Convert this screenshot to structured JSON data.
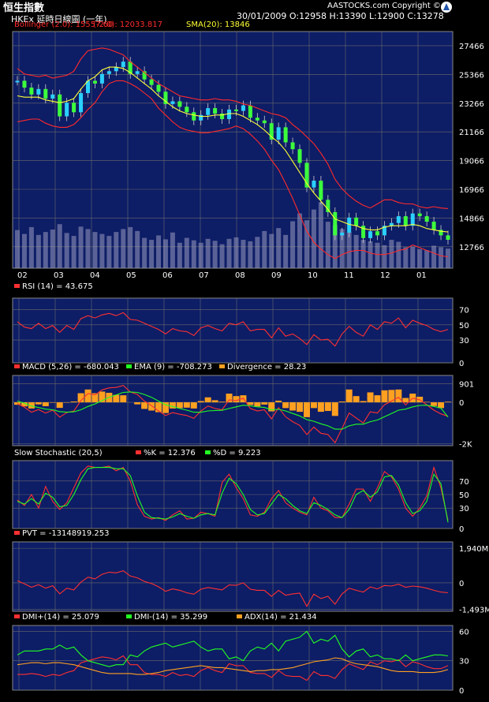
{
  "header": {
    "title": "恒生指數",
    "subtitle": "HKEx 延時日線圖 (一年)",
    "ohlc": "30/01/2009  O:12958  H:13390  L:12900  C:13278",
    "brand": "AASTOCKS.com Copyright ©"
  },
  "colors": {
    "panel_bg": "#0d1d66",
    "grid": "#6b6b6b",
    "price_up": "#2ad0ff",
    "price_down": "#3cff3c",
    "bollinger": "#ff2a2a",
    "sma": "#ffff33",
    "volume": "#9b9bc0",
    "rsi": "#ff3030",
    "macd": "#ff3030",
    "ema": "#22ff22",
    "divergence": "#ffa020",
    "k": "#ff3030",
    "d": "#22ff22",
    "pvt": "#ff3030",
    "dmi_plus": "#ff3030",
    "dmi_minus": "#22ff22",
    "adx": "#ffa020"
  },
  "chart_data": [
    {
      "type": "line",
      "panel": "price",
      "legend": [
        "Bollinger (2.0): 15557.60",
        "(-2.0): 12033.817",
        "SMA(20): 13846"
      ],
      "x_ticks": [
        "02",
        "03",
        "04",
        "05",
        "06",
        "07",
        "08",
        "09",
        "10",
        "11",
        "12",
        "01"
      ],
      "y_ticks": [
        27466,
        25366,
        23266,
        21166,
        19066,
        16966,
        14866,
        12766
      ],
      "ylim": [
        11200,
        28500
      ],
      "series": [
        {
          "name": "Close",
          "values": [
            24900,
            24400,
            23900,
            24300,
            23600,
            23900,
            22300,
            23300,
            22600,
            24000,
            24900,
            24700,
            25400,
            25600,
            25900,
            26300,
            25400,
            25600,
            25000,
            24600,
            24100,
            23200,
            23400,
            23000,
            22600,
            22000,
            22400,
            22900,
            22500,
            22100,
            22800,
            22700,
            23100,
            22200,
            22000,
            21800,
            20600,
            21500,
            20400,
            19900,
            18900,
            17100,
            17600,
            16200,
            15300,
            13600,
            13800,
            14900,
            14300,
            13400,
            13900,
            13600,
            14300,
            14500,
            15000,
            14300,
            15200,
            15000,
            14600,
            14000,
            13600,
            13278
          ]
        },
        {
          "name": "Bollinger Upper",
          "values": [
            25800,
            25400,
            25300,
            25200,
            25300,
            25100,
            25200,
            25300,
            25600,
            26500,
            27100,
            27200,
            27300,
            27200,
            27000,
            26800,
            26300,
            25900,
            25500,
            25100,
            24700,
            24400,
            24100,
            23800,
            23700,
            23600,
            23500,
            23500,
            23600,
            23500,
            23500,
            23400,
            23200,
            23100,
            22900,
            22700,
            22500,
            22400,
            22200,
            21700,
            21300,
            20800,
            20300,
            19600,
            18800,
            17700,
            17000,
            16500,
            16100,
            15800,
            15600,
            15900,
            16200,
            16200,
            16000,
            15900,
            15900,
            15700,
            15600,
            15700,
            15600,
            15558
          ]
        },
        {
          "name": "Bollinger Lower",
          "values": [
            21900,
            22000,
            22100,
            22100,
            21800,
            21600,
            21500,
            21500,
            21700,
            22200,
            22800,
            23300,
            24100,
            24700,
            24900,
            24900,
            24700,
            24400,
            24000,
            23600,
            22900,
            22400,
            21900,
            21500,
            21300,
            21200,
            21100,
            21100,
            21200,
            21300,
            21400,
            21600,
            21400,
            21000,
            20500,
            19900,
            19100,
            18400,
            17400,
            16300,
            15100,
            13900,
            13100,
            12600,
            12200,
            11900,
            12200,
            12400,
            12500,
            12500,
            12300,
            12200,
            12200,
            12300,
            12500,
            12600,
            12900,
            12700,
            12500,
            12300,
            12100,
            12034
          ]
        },
        {
          "name": "SMA",
          "values": [
            23800,
            23700,
            23700,
            23700,
            23500,
            23400,
            23300,
            23400,
            23600,
            24300,
            24900,
            25200,
            25700,
            25900,
            25900,
            25800,
            25500,
            25100,
            24700,
            24300,
            23800,
            23400,
            23000,
            22700,
            22500,
            22400,
            22300,
            22300,
            22400,
            22400,
            22500,
            22500,
            22300,
            22000,
            21700,
            21300,
            20800,
            20400,
            19800,
            19000,
            18200,
            17400,
            16700,
            16100,
            15500,
            14800,
            14600,
            14400,
            14300,
            14100,
            14000,
            14000,
            14200,
            14300,
            14300,
            14300,
            14400,
            14300,
            14100,
            14000,
            13900,
            13846
          ]
        }
      ],
      "volume": [
        78,
        70,
        84,
        68,
        74,
        79,
        90,
        72,
        66,
        85,
        80,
        74,
        70,
        66,
        74,
        80,
        84,
        76,
        62,
        58,
        67,
        59,
        73,
        52,
        62,
        57,
        52,
        60,
        56,
        49,
        60,
        63,
        58,
        55,
        64,
        76,
        70,
        82,
        68,
        96,
        112,
        98,
        120,
        135,
        95,
        88,
        80,
        74,
        68,
        58,
        55,
        52,
        47,
        58,
        54,
        43,
        44,
        39,
        37,
        46,
        43,
        40
      ]
    },
    {
      "type": "line",
      "panel": "rsi",
      "legend": [
        "RSI (14) = 43.675"
      ],
      "y_ticks": [
        70,
        50,
        30,
        0
      ],
      "ylim": [
        0,
        85
      ],
      "series": [
        {
          "name": "RSI (14)",
          "values": [
            54,
            47,
            45,
            52,
            45,
            49,
            40,
            49,
            44,
            58,
            62,
            59,
            63,
            65,
            62,
            66,
            57,
            56,
            52,
            48,
            44,
            38,
            45,
            42,
            41,
            36,
            46,
            49,
            45,
            42,
            52,
            50,
            54,
            42,
            44,
            44,
            33,
            46,
            35,
            38,
            32,
            24,
            37,
            30,
            31,
            22,
            38,
            48,
            40,
            35,
            50,
            44,
            54,
            52,
            59,
            46,
            56,
            52,
            49,
            44,
            41,
            44
          ]
        }
      ]
    },
    {
      "type": "line",
      "panel": "macd",
      "legend": [
        "MACD (5,26) = -680.043",
        "EMA (9) = -708.273",
        "Divergence = 28.23"
      ],
      "y_ticks": [
        901,
        0,
        -2000
      ],
      "y_tick_labels": [
        "901",
        "0",
        "-2K"
      ],
      "ylim": [
        -2100,
        1300
      ],
      "series": [
        {
          "name": "MACD (5,26)",
          "values": [
            -60,
            -240,
            -480,
            -350,
            -520,
            -380,
            -720,
            -500,
            -420,
            80,
            420,
            360,
            600,
            700,
            720,
            820,
            500,
            380,
            60,
            -160,
            -420,
            -640,
            -500,
            -580,
            -640,
            -780,
            -420,
            -180,
            -300,
            -360,
            120,
            80,
            200,
            -300,
            -420,
            -360,
            -800,
            -260,
            -700,
            -940,
            -1120,
            -1560,
            -1200,
            -1500,
            -1560,
            -1960,
            -1260,
            -520,
            -760,
            -1000,
            -460,
            -520,
            -120,
            60,
            240,
            -120,
            200,
            120,
            -120,
            -380,
            -560,
            -680
          ]
        },
        {
          "name": "EMA (9)",
          "values": [
            60,
            -40,
            -180,
            -250,
            -330,
            -360,
            -450,
            -480,
            -460,
            -360,
            -200,
            -80,
            80,
            240,
            360,
            480,
            500,
            480,
            380,
            240,
            60,
            -120,
            -200,
            -300,
            -380,
            -480,
            -480,
            -420,
            -400,
            -390,
            -300,
            -220,
            -140,
            -170,
            -220,
            -250,
            -360,
            -340,
            -420,
            -540,
            -660,
            -840,
            -920,
            -1040,
            -1140,
            -1300,
            -1300,
            -1140,
            -1060,
            -1060,
            -940,
            -860,
            -700,
            -540,
            -380,
            -330,
            -220,
            -150,
            -140,
            -200,
            -280,
            -708
          ]
        }
      ],
      "divergence": [
        -120,
        -200,
        -300,
        -100,
        -190,
        -20,
        -270,
        -20,
        40,
        440,
        620,
        440,
        520,
        460,
        360,
        340,
        0,
        -100,
        -320,
        -400,
        -480,
        -520,
        -300,
        -280,
        -260,
        -300,
        60,
        240,
        100,
        30,
        420,
        300,
        340,
        -130,
        -200,
        -110,
        -440,
        80,
        -280,
        -400,
        -460,
        -720,
        -280,
        -460,
        -420,
        -660,
        40,
        620,
        300,
        60,
        480,
        340,
        580,
        600,
        620,
        210,
        420,
        270,
        20,
        -180,
        -280,
        28
      ]
    },
    {
      "type": "line",
      "panel": "stochastic",
      "legend": [
        "Slow Stochastic (20,5)",
        "%K = 12.376",
        "%D = 9.223"
      ],
      "y_ticks": [
        70,
        50,
        30,
        0
      ],
      "ylim": [
        0,
        100
      ],
      "series": [
        {
          "name": "%K",
          "values": [
            42,
            34,
            50,
            30,
            62,
            40,
            28,
            38,
            60,
            82,
            92,
            90,
            90,
            92,
            85,
            90,
            70,
            35,
            18,
            14,
            16,
            12,
            20,
            26,
            14,
            15,
            24,
            22,
            18,
            68,
            80,
            60,
            44,
            20,
            18,
            24,
            44,
            56,
            38,
            30,
            24,
            20,
            46,
            30,
            26,
            16,
            16,
            36,
            58,
            58,
            40,
            60,
            84,
            76,
            58,
            30,
            18,
            30,
            48,
            90,
            60,
            12
          ]
        },
        {
          "name": "%D",
          "values": [
            40,
            36,
            44,
            36,
            52,
            46,
            32,
            34,
            50,
            72,
            88,
            90,
            90,
            90,
            88,
            88,
            78,
            48,
            24,
            16,
            15,
            14,
            17,
            22,
            18,
            15,
            20,
            22,
            20,
            52,
            74,
            66,
            50,
            28,
            20,
            22,
            36,
            50,
            44,
            34,
            26,
            22,
            38,
            34,
            28,
            20,
            16,
            28,
            50,
            56,
            46,
            54,
            76,
            78,
            64,
            38,
            22,
            26,
            40,
            80,
            66,
            9
          ]
        }
      ]
    },
    {
      "type": "line",
      "panel": "pvt",
      "legend": [
        "PVT = -13148919.253"
      ],
      "y_ticks": [
        1940,
        0,
        -1493
      ],
      "y_tick_labels": [
        "1,940M",
        "0",
        "-1,493M"
      ],
      "ylim": [
        -1600,
        2300
      ],
      "series": [
        {
          "name": "PVT",
          "values": [
            120,
            -60,
            -250,
            -100,
            -300,
            -160,
            -620,
            -300,
            -400,
            40,
            320,
            220,
            480,
            600,
            560,
            680,
            380,
            280,
            80,
            -40,
            -220,
            -480,
            -340,
            -420,
            -560,
            -640,
            -360,
            -260,
            -330,
            -400,
            -120,
            -140,
            0,
            -360,
            -420,
            -420,
            -760,
            -420,
            -700,
            -620,
            -580,
            -1320,
            -640,
            -880,
            -760,
            -1200,
            -620,
            -300,
            -420,
            -520,
            -230,
            -340,
            -150,
            -180,
            -80,
            -250,
            -180,
            -220,
            -300,
            -420,
            -520,
            -560
          ]
        }
      ]
    },
    {
      "type": "line",
      "panel": "dmi",
      "legend": [
        "DMI+(14) = 25.079",
        "DMI-(14) = 35.299",
        "ADX(14) = 21.434"
      ],
      "y_ticks": [
        60,
        30,
        0
      ],
      "ylim": [
        0,
        66
      ],
      "series": [
        {
          "name": "DMI+(14)",
          "values": [
            16,
            16,
            17,
            16,
            14,
            16,
            15,
            18,
            20,
            28,
            30,
            32,
            34,
            33,
            31,
            35,
            26,
            26,
            18,
            16,
            16,
            14,
            18,
            15,
            16,
            14,
            20,
            23,
            20,
            18,
            27,
            25,
            25,
            18,
            17,
            17,
            13,
            20,
            15,
            14,
            14,
            10,
            19,
            15,
            15,
            12,
            21,
            27,
            24,
            21,
            29,
            26,
            30,
            29,
            31,
            24,
            29,
            27,
            24,
            22,
            22,
            25
          ]
        },
        {
          "name": "DMI-(14)",
          "values": [
            36,
            40,
            40,
            40,
            42,
            42,
            46,
            42,
            44,
            36,
            30,
            28,
            26,
            24,
            26,
            26,
            36,
            34,
            40,
            44,
            46,
            48,
            44,
            46,
            48,
            50,
            44,
            40,
            42,
            42,
            32,
            34,
            30,
            40,
            44,
            42,
            48,
            40,
            50,
            52,
            54,
            60,
            48,
            52,
            50,
            56,
            42,
            34,
            40,
            42,
            34,
            36,
            32,
            32,
            30,
            36,
            30,
            32,
            34,
            36,
            36,
            35
          ]
        },
        {
          "name": "ADX(14)",
          "values": [
            26,
            27,
            28,
            28,
            27,
            28,
            28,
            27,
            26,
            24,
            22,
            20,
            18,
            17,
            17,
            17,
            17,
            16,
            16,
            17,
            18,
            20,
            21,
            22,
            23,
            24,
            25,
            24,
            23,
            23,
            22,
            21,
            20,
            19,
            20,
            20,
            21,
            21,
            22,
            23,
            25,
            27,
            29,
            30,
            31,
            33,
            32,
            29,
            27,
            26,
            25,
            24,
            22,
            20,
            19,
            19,
            19,
            18,
            18,
            18,
            19,
            21
          ]
        }
      ]
    }
  ]
}
